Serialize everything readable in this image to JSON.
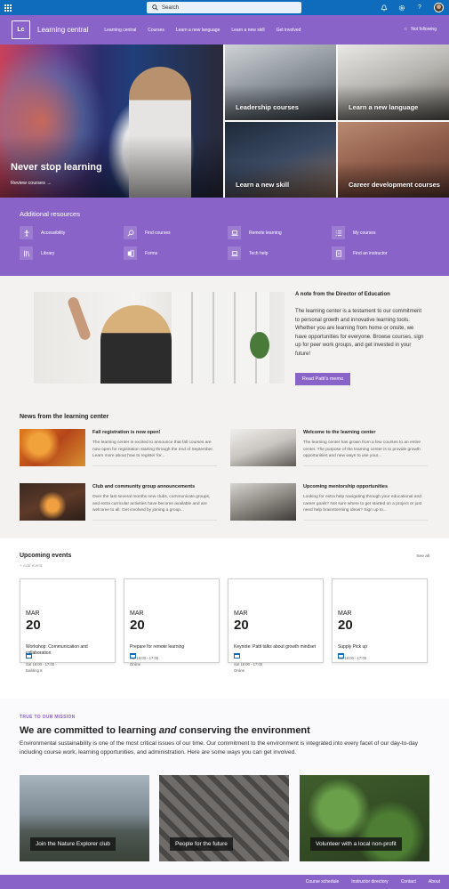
{
  "suitebar": {
    "search_placeholder": "Search",
    "icons": [
      "app-launcher-icon",
      "bell-icon",
      "settings-icon",
      "help-icon",
      "avatar"
    ]
  },
  "site": {
    "logo": "Lc",
    "title": "Learning central",
    "nav": [
      "Learning central",
      "Courses",
      "Learn a new language",
      "Learn a new skill",
      "Get involved"
    ],
    "follow_label": "Not following"
  },
  "hero": {
    "main_title": "Never stop learning",
    "main_link": "Review courses →",
    "tiles": [
      "Leadership courses",
      "Learn a new language",
      "Learn a new skill",
      "Career development courses"
    ]
  },
  "resources": {
    "title": "Additional resources",
    "items": [
      "Accessibility",
      "Find courses",
      "Remote learning",
      "My courses",
      "Library",
      "Forms",
      "Tech help",
      "Find an instructor"
    ]
  },
  "note": {
    "heading": "A note from the Director of Education",
    "body": "The learning center is a testament to our commitment to personal growth and innovative learning tools. Whether you are learning from home or onsite, we have opportunities for everyone. Browse courses, sign up for peer work groups, and get invested in your future!",
    "button": "Read Patti's memo"
  },
  "news": {
    "title": "News from the learning center",
    "items": [
      {
        "title": "Fall registration is now open!",
        "body": "The learning center is excited to announce that fall courses are now open for registration starting through the end of September. Learn more about how to register for..."
      },
      {
        "title": "Welcome to the learning center",
        "body": "The learning center has grown from a few courses to an entire center. The purpose of the learning center is to provide growth opportunities and new ways to use your..."
      },
      {
        "title": "Club and community group announcements",
        "body": "Over the last several months new clubs, communicate groups, and extra curricular activities have become available and are welcome to all. Get involved by joining a group..."
      },
      {
        "title": "Upcoming mentorship opportunities",
        "body": "Looking for extra help navigating through your educational and career goals? Not sure where to get started on a project or just need help brainstorming ideas? Sign up to..."
      }
    ]
  },
  "events": {
    "title": "Upcoming events",
    "add_label": "+ Add event",
    "see_all": "See all",
    "items": [
      {
        "month": "MAR",
        "day": "20",
        "name": "Workshop: Communication and collaboration",
        "time": "Sat 16:00 - 17:00",
        "location": "Building 8"
      },
      {
        "month": "MAR",
        "day": "20",
        "name": "Prepare for remote learning",
        "time": "Sat 16:00 - 17:00",
        "location": "Online"
      },
      {
        "month": "MAR",
        "day": "20",
        "name": "Keynote: Patti talks about growth mindset",
        "time": "Sat 16:00 - 17:00",
        "location": "Online"
      },
      {
        "month": "MAR",
        "day": "20",
        "name": "Supply Pick up",
        "time": "Sat 16:00 - 17:00",
        "location": ""
      }
    ]
  },
  "mission": {
    "kicker": "TRUE TO OUR MISSION",
    "heading_pre": "We are committed to learning ",
    "heading_em": "and",
    "heading_post": " conserving the environment",
    "body": "Environmental sustainability is one of the most critical issues of our time. Our commitment to the environment is integrated into every facet of our day-to-day including course work, learning opportunities, and administration. Here are some ways you can get involved.",
    "cards": [
      "Join the Nature Explorer club",
      "People for the future",
      "Volunteer with a local non-profit"
    ]
  },
  "footer": {
    "links": [
      "Course schedule",
      "Instructor directory",
      "Contact",
      "About"
    ]
  },
  "colors": {
    "suite_blue": "#0f6cbd",
    "brand_purple": "#8a63c9"
  }
}
